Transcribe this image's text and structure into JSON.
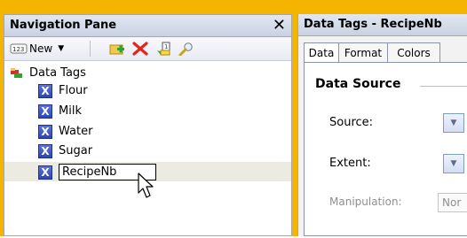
{
  "nav": {
    "title": "Navigation Pane",
    "close": "✕",
    "toolbar": {
      "new_label": "New",
      "new_icon": "new-tag-icon",
      "add_icon": "add-folder-icon",
      "delete_icon": "delete-icon",
      "rename_icon": "rename-icon",
      "search_icon": "search-icon"
    },
    "tree": {
      "root_label": "Data Tags",
      "items": [
        {
          "label": "Flour"
        },
        {
          "label": "Milk"
        },
        {
          "label": "Water"
        },
        {
          "label": "Sugar"
        }
      ],
      "editing_value": "RecipeNb",
      "item_icon_glyph": "X"
    }
  },
  "right": {
    "title": "Data Tags - RecipeNb",
    "tabs": [
      "Data",
      "Format",
      "Colors"
    ],
    "section_title": "Data Source",
    "fields": {
      "source_label": "Source:",
      "extent_label": "Extent:",
      "manipulation_label": "Manipulation:",
      "manipulation_value": "Nor"
    }
  },
  "colors": {
    "frame": "#f4b400",
    "tag_icon": "#2e45b5"
  }
}
